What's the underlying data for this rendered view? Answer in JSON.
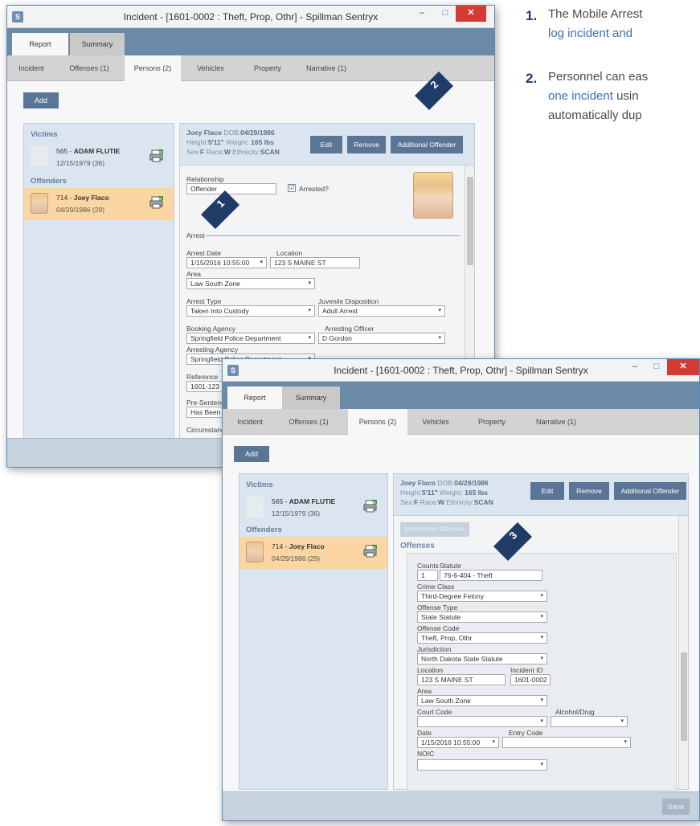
{
  "window": {
    "title": "Incident - [1601-0002 : Theft, Prop, Othr] - Spillman Sentryx",
    "app_icon": "S",
    "controls": {
      "minimize": "–",
      "maximize": "□",
      "close": "✕"
    }
  },
  "top_tabs": [
    "Report",
    "Summary"
  ],
  "sub_tabs": [
    "Incident",
    "Offenses (1)",
    "Persons (2)",
    "Vehicles",
    "Property",
    "Narrative (1)"
  ],
  "add_label": "Add",
  "victims": {
    "title": "Victims",
    "items": [
      {
        "id": "565 -",
        "name": "ADAM FLUTIE",
        "dob": "12/15/1979 (36)"
      }
    ]
  },
  "offenders": {
    "title": "Offenders",
    "items": [
      {
        "id": "714 -",
        "name": "Joey Flaco",
        "dob": "04/29/1986 (29)"
      }
    ]
  },
  "person_header": {
    "line1_label": "Joey Flaco",
    "line1_dob_label": "DOB:",
    "line1_dob": "04/29/1986",
    "line2_height_label": "Height:",
    "line2_height": "5'11\"",
    "line2_weight_label": "Weight:",
    "line2_weight": "165 lbs",
    "line3_sex_label": "Sex:",
    "line3_sex": "F",
    "line3_race_label": "Race:",
    "line3_race": "W",
    "line3_eth_label": "Ethnicity:",
    "line3_eth": "SCAN"
  },
  "header_buttons": {
    "edit": "Edit",
    "remove": "Remove",
    "additional_offender": "Additional Offender"
  },
  "arrest_form": {
    "relationship_label": "Relationship",
    "relationship_value": "Offender",
    "arrested_label": "Arrested?",
    "arrested_checked": "☑",
    "arrest_section": "Arrest",
    "arrest_date_label": "Arrest Date",
    "arrest_date_value": "1/15/2016 10:55:00",
    "location_label": "Location",
    "location_value": "123 S MAINE ST",
    "area_label": "Area",
    "area_value": "Law South Zone",
    "arrest_type_label": "Arrest Type",
    "arrest_type_value": "Taken Into Custody",
    "juvenile_label": "Juvenile Disposition",
    "juvenile_value": "Adult Arrest",
    "booking_label": "Booking Agency",
    "booking_value": "Springfield Police Department",
    "arresting_officer_label": "Arresting Officer",
    "arresting_officer_value": "D Gordon",
    "arresting_agency_label": "Arresting Agency",
    "arresting_agency_value": "Springfield Police Department",
    "reference_label": "Reference",
    "reference_value": "1601-123",
    "presentence_label": "Pre-Sentenc",
    "presentence_value": "Has Been A",
    "circumstance_label": "Circumstanc"
  },
  "offense_form": {
    "import_button": "Import from Offenses Tab",
    "section_title": "Offenses",
    "counts_label": "Counts",
    "counts_value": "1",
    "statute_label": "Statute",
    "statute_value": "76-6-404 - Theft",
    "crime_class_label": "Crime Class",
    "crime_class_value": "Third-Degree Felony",
    "offense_type_label": "Offense Type",
    "offense_type_value": "State Statute",
    "offense_code_label": "Offense Code",
    "offense_code_value": "Theft, Prop, Othr",
    "jurisdiction_label": "Jurisdiction",
    "jurisdiction_value": "North Dakota State Statute",
    "location_label": "Location",
    "location_value": "123 S MAINE ST",
    "incident_id_label": "Incident ID",
    "incident_id_value": "1601-0002",
    "area_label": "Area",
    "area_value": "Law South Zone",
    "court_code_label": "Court Code",
    "court_code_value": "",
    "alcohol_label": "Alcohol/Drug",
    "alcohol_value": "",
    "date_label": "Date",
    "date_value": "1/15/2016 10:55:00",
    "entry_code_label": "Entry Code",
    "entry_code_value": "",
    "noic_label": "NOIC",
    "noic_value": ""
  },
  "save_label": "Save",
  "markers": [
    "1",
    "2",
    "3"
  ],
  "callouts": [
    {
      "num": "1.",
      "line1": "The Mobile Arrest",
      "line2": "log incident and"
    },
    {
      "num": "2.",
      "line1": "Personnel can eas",
      "line2_blue": "one incident",
      "line2_rest": " usin",
      "line3": "automatically dup"
    }
  ],
  "icons": {
    "avatar": "person-silhouette-icon",
    "print": "printer-icon",
    "dropdown": "▾"
  },
  "colors": {
    "accent": "#5a7595",
    "selected_row": "#fbd6a2",
    "marker": "#1f3b66",
    "callout_blue": "#3b6fb5"
  }
}
